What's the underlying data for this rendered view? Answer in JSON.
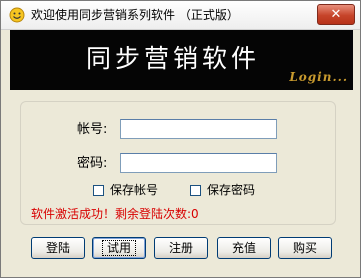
{
  "window": {
    "title": "欢迎使用同步营销系列软件 （正式版）",
    "close_label": "✕",
    "app_icon": "smiley-face-icon"
  },
  "banner": {
    "title": "同步营销软件",
    "login_text": "Login..."
  },
  "form": {
    "account_label": "帐号:",
    "account_value": "",
    "password_label": "密码:",
    "password_value": "",
    "save_account_label": "保存帐号",
    "save_account_checked": false,
    "save_password_label": "保存密码",
    "save_password_checked": false
  },
  "status": {
    "message": "软件激活成功！剩余登陆次数:0",
    "color": "#d80000"
  },
  "buttons": {
    "login": "登陆",
    "trial": "试用",
    "register": "注册",
    "recharge": "充值",
    "buy": "购买"
  }
}
